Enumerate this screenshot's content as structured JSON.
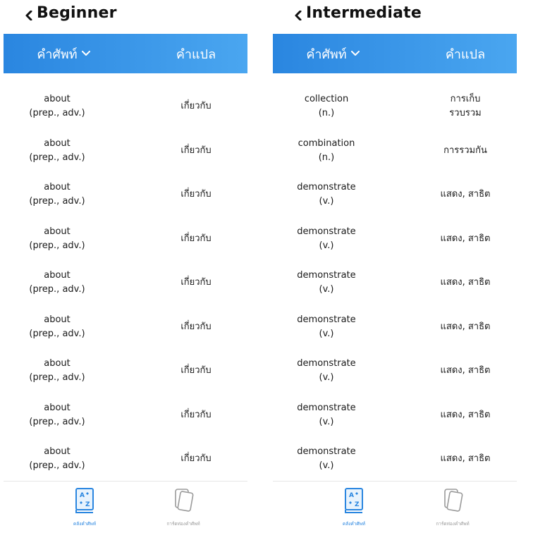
{
  "colors": {
    "accent": "#2a86e0",
    "accent_light": "#4aa6f0",
    "text": "#1a1a1a",
    "inactive": "#9a9a9a"
  },
  "panels": [
    {
      "title": "Beginner",
      "header": {
        "word_col": "คำศัพท์",
        "translation_col": "คำแปล"
      },
      "rows": [
        {
          "word": "about",
          "pos": "(prep., adv.)",
          "translation": [
            "เกี่ยวกับ"
          ]
        },
        {
          "word": "about",
          "pos": "(prep., adv.)",
          "translation": [
            "เกี่ยวกับ"
          ]
        },
        {
          "word": "about",
          "pos": "(prep., adv.)",
          "translation": [
            "เกี่ยวกับ"
          ]
        },
        {
          "word": "about",
          "pos": "(prep., adv.)",
          "translation": [
            "เกี่ยวกับ"
          ]
        },
        {
          "word": "about",
          "pos": "(prep., adv.)",
          "translation": [
            "เกี่ยวกับ"
          ]
        },
        {
          "word": "about",
          "pos": "(prep., adv.)",
          "translation": [
            "เกี่ยวกับ"
          ]
        },
        {
          "word": "about",
          "pos": "(prep., adv.)",
          "translation": [
            "เกี่ยวกับ"
          ]
        },
        {
          "word": "about",
          "pos": "(prep., adv.)",
          "translation": [
            "เกี่ยวกับ"
          ]
        },
        {
          "word": "about",
          "pos": "(prep., adv.)",
          "translation": [
            "เกี่ยวกับ"
          ]
        }
      ],
      "nav": [
        {
          "label": "คลังคำศัพท์",
          "icon": "vocab-book-icon",
          "active": true
        },
        {
          "label": "การ์ดท่องคำศัพท์",
          "icon": "flashcards-icon",
          "active": false
        }
      ]
    },
    {
      "title": "Intermediate",
      "header": {
        "word_col": "คำศัพท์",
        "translation_col": "คำแปล"
      },
      "rows": [
        {
          "word": "collection",
          "pos": "(n.)",
          "translation": [
            "การเก็บ",
            "รวบรวม"
          ]
        },
        {
          "word": "combination",
          "pos": "(n.)",
          "translation": [
            "การรวมกัน"
          ]
        },
        {
          "word": "demonstrate",
          "pos": "(v.)",
          "translation": [
            "แสดง, สาธิต"
          ]
        },
        {
          "word": "demonstrate",
          "pos": "(v.)",
          "translation": [
            "แสดง, สาธิต"
          ]
        },
        {
          "word": "demonstrate",
          "pos": "(v.)",
          "translation": [
            "แสดง, สาธิต"
          ]
        },
        {
          "word": "demonstrate",
          "pos": "(v.)",
          "translation": [
            "แสดง, สาธิต"
          ]
        },
        {
          "word": "demonstrate",
          "pos": "(v.)",
          "translation": [
            "แสดง, สาธิต"
          ]
        },
        {
          "word": "demonstrate",
          "pos": "(v.)",
          "translation": [
            "แสดง, สาธิต"
          ]
        },
        {
          "word": "demonstrate",
          "pos": "(v.)",
          "translation": [
            "แสดง, สาธิต"
          ]
        }
      ],
      "nav": [
        {
          "label": "คลังคำศัพท์",
          "icon": "vocab-book-icon",
          "active": true
        },
        {
          "label": "การ์ดท่องคำศัพท์",
          "icon": "flashcards-icon",
          "active": false
        }
      ]
    }
  ]
}
